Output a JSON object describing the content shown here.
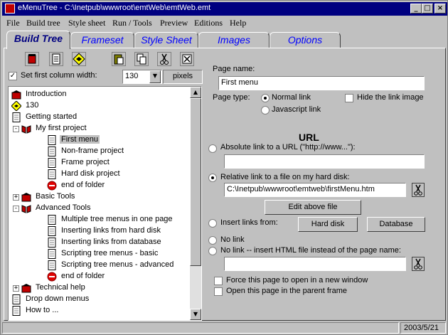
{
  "window": {
    "title": "eMenuTree - C:\\Inetpub\\wwwroot\\emtWeb\\emtWeb.emt",
    "minimize": "_",
    "maximize": "□",
    "close": "×"
  },
  "menu": [
    "File",
    "Build tree",
    "Style sheet",
    "Run / Tools",
    "Preview",
    "Editions",
    "Help"
  ],
  "tabs": [
    "Build Tree",
    "Frameset",
    "Style Sheet",
    "Images",
    "Options"
  ],
  "active_tab": "Build Tree",
  "toolbar": {
    "icons": [
      "add-folder-icon",
      "add-page-icon",
      "add-separator-icon",
      "paste-icon",
      "copy-icon",
      "cut-icon",
      "delete-icon"
    ]
  },
  "column_width": {
    "checked": true,
    "label": "Set first column width:",
    "value": "130",
    "unit": "pixels"
  },
  "tree": [
    {
      "label": "Introduction",
      "icon": "red-book-icon"
    },
    {
      "label": "130",
      "icon": "yellow-diamond-icon"
    },
    {
      "label": "Getting started",
      "icon": "page-icon"
    },
    {
      "label": "My first project",
      "icon": "open-book-icon",
      "expander": "-"
    },
    {
      "label": "First menu",
      "icon": "page-icon",
      "selected": true
    },
    {
      "label": "Non-frame project",
      "icon": "page-icon"
    },
    {
      "label": "Frame project",
      "icon": "page-icon"
    },
    {
      "label": "Hard disk project",
      "icon": "page-icon"
    },
    {
      "label": "end of folder",
      "icon": "stop-icon"
    },
    {
      "label": "Basic Tools",
      "icon": "red-book-icon",
      "expander": "+"
    },
    {
      "label": "Advanced Tools",
      "icon": "open-book-icon",
      "expander": "-"
    },
    {
      "label": "Multiple tree menus in one page",
      "icon": "page-icon"
    },
    {
      "label": "Inserting links from hard disk",
      "icon": "page-icon"
    },
    {
      "label": "Inserting links from database",
      "icon": "page-icon"
    },
    {
      "label": "Scripting tree menus - basic",
      "icon": "page-icon"
    },
    {
      "label": "Scripting tree menus - advanced",
      "icon": "page-icon"
    },
    {
      "label": "end of folder",
      "icon": "stop-icon"
    },
    {
      "label": "Technical help",
      "icon": "red-book-icon",
      "expander": "+"
    },
    {
      "label": "Drop down menus",
      "icon": "page-icon"
    },
    {
      "label": "How to ...",
      "icon": "page-icon"
    }
  ],
  "form": {
    "page_name_label": "Page name:",
    "page_name_value": "First menu",
    "page_type_label": "Page type:",
    "normal_link": "Normal link",
    "javascript_link": "Javascript link",
    "hide_link_image": "Hide the link image",
    "url_heading": "URL",
    "absolute_label": "Absolute link to a URL (\"http://www...\"):",
    "absolute_value": "",
    "relative_label": "Relative link to a file on my hard disk:",
    "relative_value": "C:\\Inetpub\\wwwroot\\emtweb\\firstMenu.htm",
    "edit_button": "Edit above file",
    "insert_links_label": "Insert links from:",
    "hard_disk_button": "Hard disk",
    "database_button": "Database",
    "no_link_label": "No link",
    "no_link_html_label": "No link -- insert HTML file instead of the page name:",
    "no_link_html_value": "",
    "force_new_window": "Force this page to open in a new window",
    "open_parent_frame": "Open this page in the parent frame"
  },
  "status": {
    "date": "2003/5/21"
  }
}
